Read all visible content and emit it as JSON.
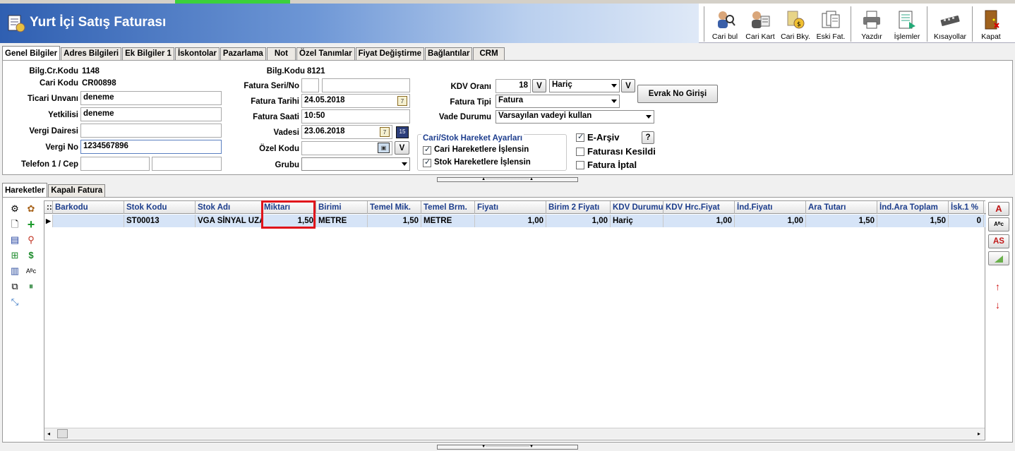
{
  "window": {
    "title": "Yurt İçi Satış Faturası"
  },
  "toolbar": [
    {
      "label": "Cari bul",
      "icon": "person-search-icon"
    },
    {
      "label": "Cari Kart",
      "icon": "person-card-icon"
    },
    {
      "label": "Cari Bky.",
      "icon": "person-balance-icon"
    },
    {
      "label": "Eski Fat.",
      "icon": "old-invoices-icon"
    },
    {
      "label": "Yazdır",
      "icon": "printer-icon"
    },
    {
      "label": "İşlemler",
      "icon": "operations-icon"
    },
    {
      "label": "Kısayollar",
      "icon": "shortcuts-icon"
    },
    {
      "label": "Kapat",
      "icon": "exit-door-icon"
    }
  ],
  "tabs": [
    "Genel Bilgiler",
    "Adres Bilgileri",
    "Ek Bilgiler 1",
    "İskontolar",
    "Pazarlama",
    "Not",
    "Özel Tanımlar",
    "Fiyat Değiştirme",
    "Bağlantılar",
    "CRM"
  ],
  "form": {
    "bilg_cr_kodu_label": "Bilg.Cr.Kodu",
    "bilg_cr_kodu": "1148",
    "cari_kodu_label": "Cari Kodu",
    "cari_kodu": "CR00898",
    "ticari_unvani_label": "Ticari Unvanı",
    "ticari_unvani": "deneme",
    "yetkilisi_label": "Yetkilisi",
    "yetkilisi": "deneme",
    "vergi_dairesi_label": "Vergi Dairesi",
    "vergi_dairesi": "",
    "vergi_no_label": "Vergi No",
    "vergi_no": "1234567896",
    "telefon_label": "Telefon 1 / Cep",
    "telefon1": "",
    "cep": "",
    "bilg_kodu_label": "Bilg.Kodu",
    "bilg_kodu": "8121",
    "fatura_seri_no_label": "Fatura Seri/No",
    "fatura_seri": "",
    "fatura_no": "",
    "fatura_tarihi_label": "Fatura Tarihi",
    "fatura_tarihi": "24.05.2018",
    "fatura_saati_label": "Fatura Saati",
    "fatura_saati": "10:50",
    "vadesi_label": "Vadesi",
    "vadesi": "23.06.2018",
    "ozel_kodu_label": "Özel Kodu",
    "ozel_kodu": "",
    "grubu_label": "Grubu",
    "grubu": "",
    "kdv_orani_label": "KDV Oranı",
    "kdv_orani": "18",
    "kdv_durum": "Hariç",
    "fatura_tipi_label": "Fatura Tipi",
    "fatura_tipi": "Fatura",
    "vade_durumu_label": "Vade Durumu",
    "vade_durumu": "Varsayılan vadeyi kullan",
    "evrak_no_button": "Evrak No Girişi",
    "v_button": "V",
    "help_button": "?",
    "hareket_group_title": "Cari/Stok Hareket Ayarları",
    "cari_hareket_label": "Cari Hareketlere İşlensin",
    "cari_hareket_checked": true,
    "stok_hareket_label": "Stok Hareketlere İşlensin",
    "stok_hareket_checked": true,
    "e_arsiv_label": "E-Arşiv",
    "e_arsiv_checked": true,
    "faturasi_kesildi_label": "Faturası Kesildi",
    "faturasi_kesildi_checked": false,
    "fatura_iptal_label": "Fatura İptal",
    "fatura_iptal_checked": false
  },
  "bottom_tabs": [
    "Hareketler",
    "Kapalı Fatura"
  ],
  "grid": {
    "columns": [
      "Barkodu",
      "Stok Kodu",
      "Stok Adı",
      "Miktarı",
      "Birimi",
      "Temel Mik.",
      "Temel Brm.",
      "Fiyatı",
      "Birim 2 Fiyatı",
      "KDV Durumu",
      "KDV Hrc.Fiyat",
      "İnd.Fiyatı",
      "Ara Tutarı",
      "İnd.Ara Toplam",
      "İsk.1 %"
    ],
    "rows": [
      [
        "",
        "ST00013",
        "VGA SİNYAL UZA",
        "1,50",
        "METRE",
        "1,50",
        "METRE",
        "1,00",
        "1,00",
        "Hariç",
        "1,00",
        "1,00",
        "1,50",
        "1,50",
        "0"
      ]
    ]
  },
  "side_buttons": [
    "A",
    "AS"
  ],
  "highlight_color": "#e0141b"
}
